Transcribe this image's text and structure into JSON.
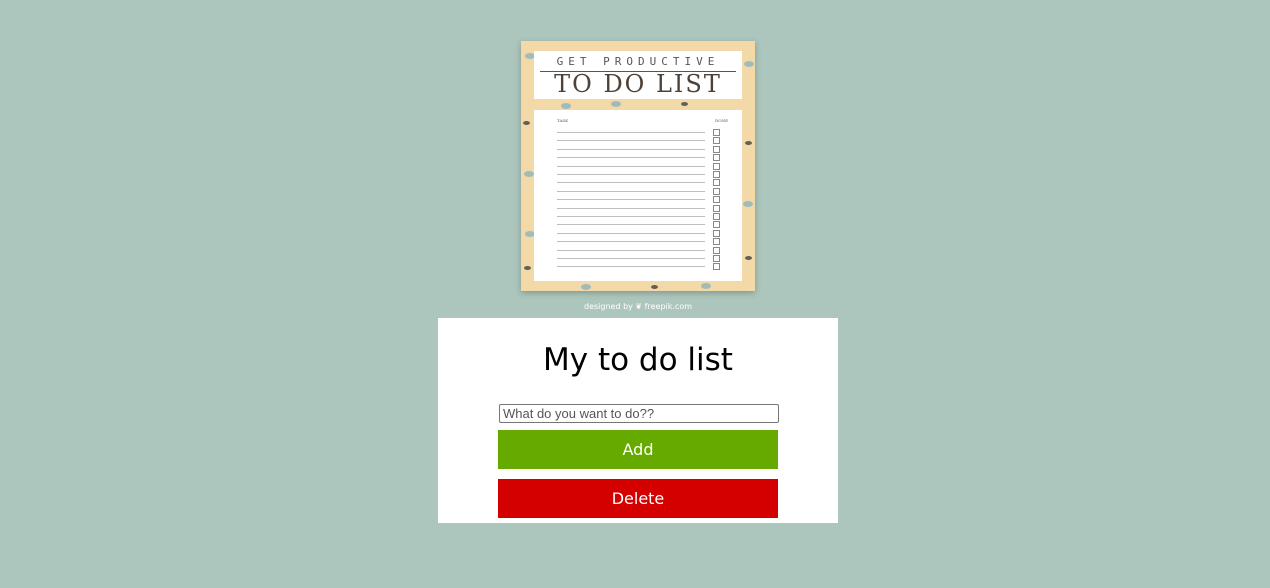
{
  "poster": {
    "subtitle": "GET PRODUCTIVE",
    "title": "TO DO LIST",
    "col_task": "TASK",
    "col_done": "DONE",
    "rows": 17,
    "credit": "designed by ❦ freepik.com"
  },
  "card": {
    "heading": "My to do list",
    "input_placeholder": "What do you want to do??",
    "add_label": "Add",
    "delete_label": "Delete"
  },
  "colors": {
    "page_background": "#adc6bd",
    "add_button": "#66aa00",
    "delete_button": "#d40000",
    "poster_background": "#f3d9a8"
  }
}
